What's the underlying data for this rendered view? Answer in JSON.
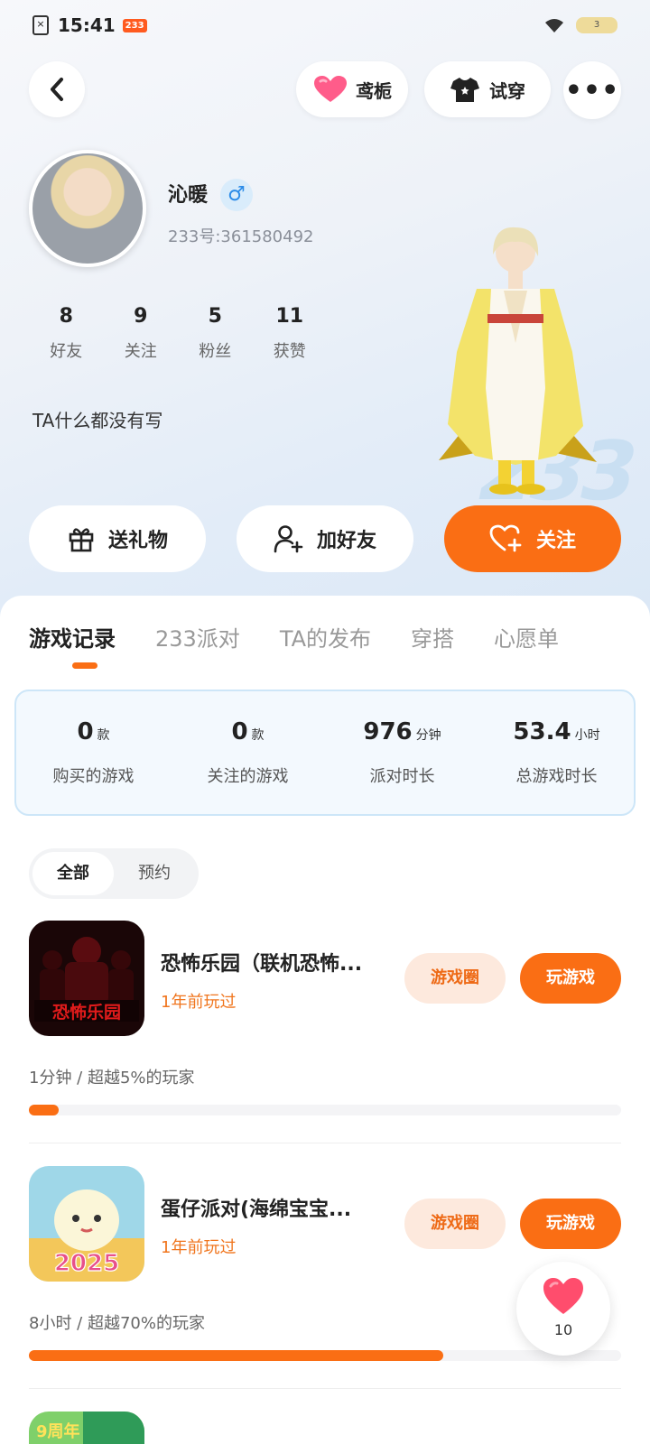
{
  "status_bar": {
    "time": "15:41",
    "app_badge": "233",
    "battery": "3"
  },
  "header": {
    "gift_label": "鸢栀",
    "try_label": "试穿"
  },
  "profile": {
    "name": "沁暖",
    "gender_symbol": "♂",
    "uid": "233号:361580492",
    "stats": [
      {
        "value": "8",
        "label": "好友"
      },
      {
        "value": "9",
        "label": "关注"
      },
      {
        "value": "5",
        "label": "粉丝"
      },
      {
        "value": "11",
        "label": "获赞"
      }
    ],
    "bio": "TA什么都没有写"
  },
  "actions": {
    "send_gift": "送礼物",
    "add_friend": "加好友",
    "follow": "关注"
  },
  "tabs": [
    "游戏记录",
    "233派对",
    "TA的发布",
    "穿搭",
    "心愿单"
  ],
  "summary": [
    {
      "value": "0",
      "unit": "款",
      "label": "购买的游戏"
    },
    {
      "value": "0",
      "unit": "款",
      "label": "关注的游戏"
    },
    {
      "value": "976",
      "unit": "分钟",
      "label": "派对时长"
    },
    {
      "value": "53.4",
      "unit": "小时",
      "label": "总游戏时长"
    }
  ],
  "filter": {
    "all": "全部",
    "reserve": "预约"
  },
  "games": [
    {
      "title": "恐怖乐园（联机恐怖...",
      "icon_text": "恐怖乐园",
      "played": "1年前玩过",
      "circle_label": "游戏圈",
      "play_label": "玩游戏",
      "meta": "1分钟 / 超越5%的玩家",
      "progress_fraction": 0.05
    },
    {
      "title": "蛋仔派对(海绵宝宝...",
      "icon_text": "2025",
      "played": "1年前玩过",
      "circle_label": "游戏圈",
      "play_label": "玩游戏",
      "meta": "8小时 / 超越70%的玩家",
      "progress_fraction": 0.7
    }
  ],
  "third_game_icon_text": "9周年",
  "float_like": {
    "count": "10"
  },
  "colors": {
    "accent": "#fa6e14",
    "accent_light": "#fde9dd",
    "summary_border": "#cde6f8"
  }
}
